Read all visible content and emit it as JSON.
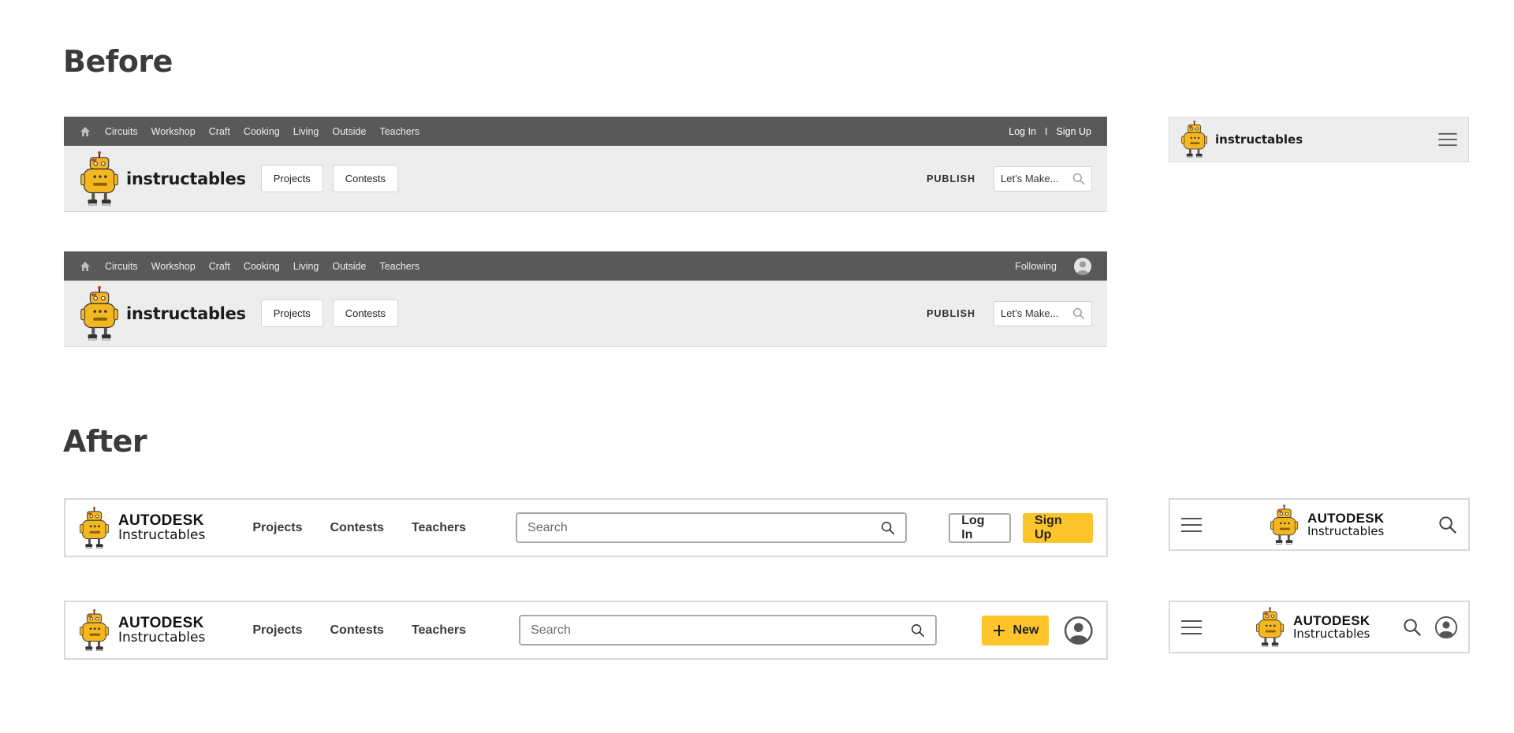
{
  "sections": {
    "before": "Before",
    "after": "After"
  },
  "old_header": {
    "categories": [
      "Circuits",
      "Workshop",
      "Craft",
      "Cooking",
      "Living",
      "Outside",
      "Teachers"
    ],
    "login": "Log In",
    "separator": "I",
    "signup": "Sign Up",
    "following": "Following",
    "logo_text": "instructables",
    "projects": "Projects",
    "contests": "Contests",
    "publish": "PUBLISH",
    "search_placeholder": "Let’s Make..."
  },
  "old_mobile": {
    "logo_text": "instructables"
  },
  "new_header": {
    "brand_line1": "AUTODESK",
    "brand_line2": "Instructables",
    "nav": [
      "Projects",
      "Contests",
      "Teachers"
    ],
    "search_placeholder": "Search",
    "login": "Log In",
    "signup": "Sign Up",
    "new": "New"
  },
  "new_mobile": {
    "brand_line1": "AUTODESK",
    "brand_line2": "Instructables"
  },
  "colors": {
    "topbar": "#595959",
    "accent": "#fec42b",
    "old_bar": "#ededed"
  }
}
